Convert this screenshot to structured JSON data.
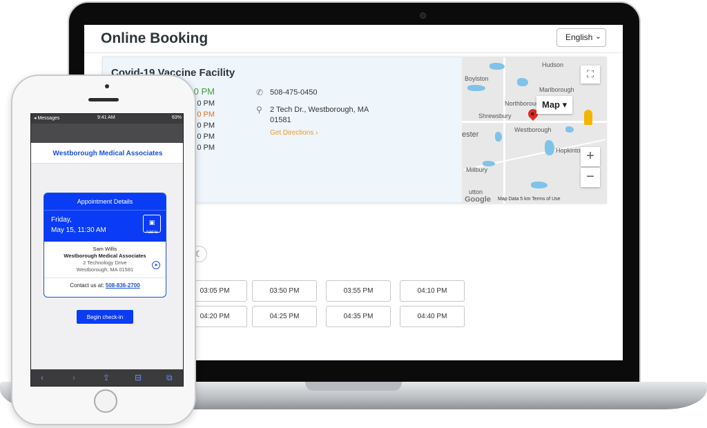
{
  "booking": {
    "title": "Online Booking",
    "language": "English",
    "facility": {
      "name": "Covid-19 Vaccine Facility",
      "hours_visible": [
        "8:00 PM",
        "0 PM",
        "0 PM",
        "0 PM",
        "0 PM",
        "0 PM"
      ],
      "phone": "508-475-0450",
      "address_line1": "2 Tech Dr., Westborough, MA",
      "address_line2": "01581",
      "directions": "Get Directions ›"
    },
    "map": {
      "mode": "Map",
      "towns": [
        "Hudson",
        "Boylston",
        "Northborough",
        "Marlborough",
        "Shrewsbury",
        "Westborough",
        "ester",
        "Hopkinton",
        "Millbury",
        "utton"
      ],
      "footer": "Map Data   5 km   Terms of Use",
      "logo": "Google",
      "colors": {
        "water": "#7fc3e8",
        "land": "#e8e8e8",
        "pin": "#d93025"
      }
    },
    "time_slots": [
      [
        "03:05 PM",
        "03:50 PM",
        "03:55 PM",
        "04:10 PM"
      ],
      [
        "04:20 PM",
        "04:25 PM",
        "04:35 PM",
        "04:40 PM"
      ]
    ]
  },
  "phone": {
    "status": {
      "carrier": "◂ Messages",
      "time": "9:41 AM",
      "battery": "63%"
    },
    "header": "Westborough Medical Associates",
    "card": {
      "title": "Appointment Details",
      "date_line1": "Friday,",
      "date_line2": "May 15, 11:30 AM",
      "add_to": "Add to",
      "patient": "Sam Willis",
      "practice": "Westborough Medical Associates",
      "street": "2 Technology Drive",
      "city": "Westborough, MA 01581",
      "contact_label": "Contact us at:",
      "contact_phone": "508-836-2700"
    },
    "checkin_label": "Begin check-in",
    "accent_color": "#0a3cf5"
  }
}
